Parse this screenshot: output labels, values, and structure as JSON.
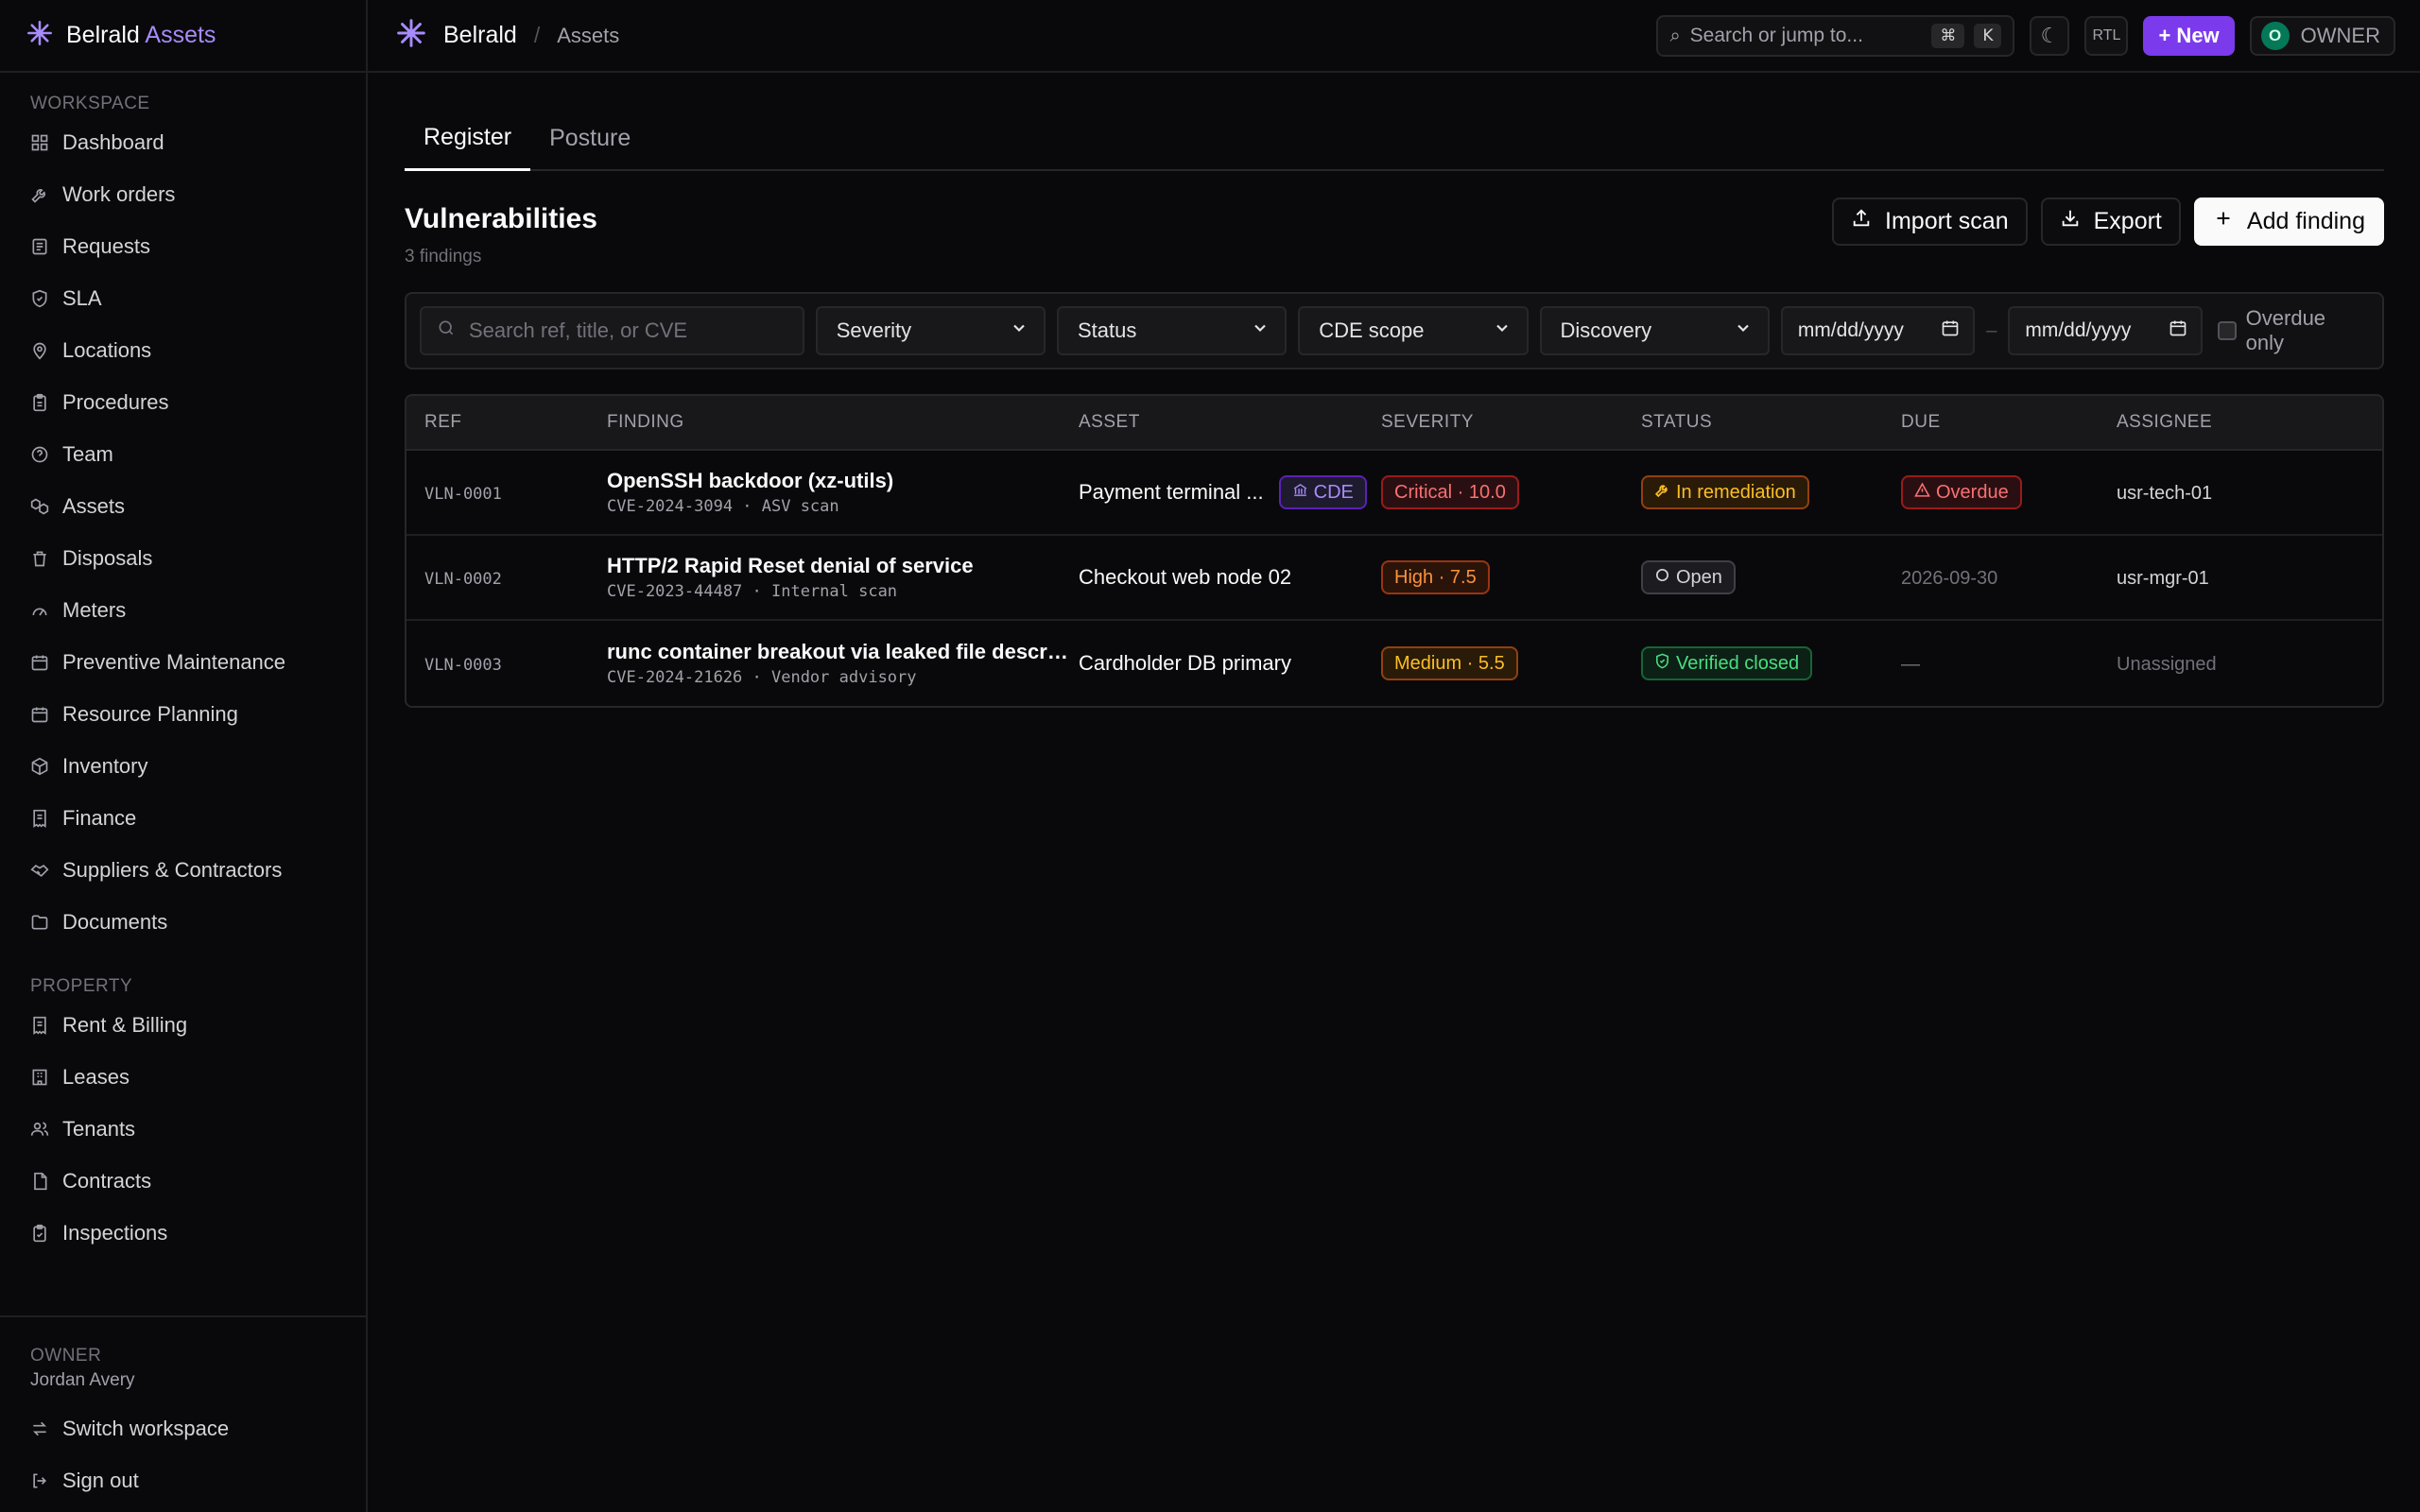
{
  "sidebar": {
    "brand": {
      "name": "Belrald",
      "accent": "Assets"
    },
    "sections": [
      {
        "label": "WORKSPACE",
        "items": [
          {
            "label": "Dashboard",
            "icon": "dashboard-icon"
          },
          {
            "label": "Work orders",
            "icon": "wrench-icon"
          },
          {
            "label": "Requests",
            "icon": "inbox-icon"
          },
          {
            "label": "SLA",
            "icon": "shield-icon"
          },
          {
            "label": "Locations",
            "icon": "pin-icon"
          },
          {
            "label": "Procedures",
            "icon": "clipboard-icon"
          },
          {
            "label": "Team",
            "icon": "help-circle-icon"
          },
          {
            "label": "Assets",
            "icon": "boxes-icon"
          },
          {
            "label": "Disposals",
            "icon": "recycle-icon"
          },
          {
            "label": "Meters",
            "icon": "gauge-icon"
          },
          {
            "label": "Preventive Maintenance",
            "icon": "calendar-icon"
          },
          {
            "label": "Resource Planning",
            "icon": "calendar-icon"
          },
          {
            "label": "Inventory",
            "icon": "package-icon"
          },
          {
            "label": "Finance",
            "icon": "receipt-icon"
          },
          {
            "label": "Suppliers & Contractors",
            "icon": "handshake-icon"
          },
          {
            "label": "Documents",
            "icon": "folder-icon"
          }
        ]
      },
      {
        "label": "PROPERTY",
        "items": [
          {
            "label": "Rent & Billing",
            "icon": "receipt-icon"
          },
          {
            "label": "Leases",
            "icon": "building-icon"
          },
          {
            "label": "Tenants",
            "icon": "users-icon"
          },
          {
            "label": "Contracts",
            "icon": "file-icon"
          },
          {
            "label": "Inspections",
            "icon": "clipboard-check-icon"
          }
        ]
      }
    ],
    "footer": {
      "role": "OWNER",
      "user": "Jordan Avery",
      "switch_label": "Switch workspace",
      "signout_label": "Sign out"
    }
  },
  "topbar": {
    "crumb_main": "Belrald",
    "crumb_sep": "/",
    "crumb_sub": "Assets",
    "search_placeholder": "Search or jump to...",
    "kbd_cmd": "⌘",
    "kbd_k": "K",
    "rtl_label": "RTL",
    "new_label": "+ New",
    "avatar_initial": "O",
    "owner_label": "OWNER"
  },
  "tabs": [
    {
      "label": "Register",
      "active": true
    },
    {
      "label": "Posture",
      "active": false
    }
  ],
  "page": {
    "title": "Vulnerabilities",
    "subtitle": "3 findings",
    "import_label": "Import scan",
    "export_label": "Export",
    "add_label": "Add finding"
  },
  "filters": {
    "search_placeholder": "Search ref, title, or CVE",
    "severity": "Severity",
    "status": "Status",
    "cde": "CDE scope",
    "discovery": "Discovery",
    "date_from": "mm/dd/yyyy",
    "date_sep": "–",
    "date_to": "mm/dd/yyyy",
    "overdue_label": "Overdue only"
  },
  "table": {
    "headers": {
      "ref": "REF",
      "finding": "FINDING",
      "asset": "ASSET",
      "severity": "SEVERITY",
      "status": "STATUS",
      "due": "DUE",
      "assignee": "ASSIGNEE"
    },
    "rows": [
      {
        "ref": "VLN-0001",
        "title": "OpenSSH backdoor (xz-utils)",
        "meta": "CVE-2024-3094 · ASV scan",
        "asset": "Payment terminal ...",
        "cde": "CDE",
        "severity": "Critical · 10.0",
        "status": "In remediation",
        "due": "Overdue",
        "assignee": "usr-tech-01"
      },
      {
        "ref": "VLN-0002",
        "title": "HTTP/2 Rapid Reset denial of service",
        "meta": "CVE-2023-44487 · Internal scan",
        "asset": "Checkout web node 02",
        "severity": "High · 7.5",
        "status": "Open",
        "due": "2026-09-30",
        "assignee": "usr-mgr-01"
      },
      {
        "ref": "VLN-0003",
        "title": "runc container breakout via leaked file descript...",
        "meta": "CVE-2024-21626 · Vendor advisory",
        "asset": "Cardholder DB primary",
        "severity": "Medium · 5.5",
        "status": "Verified closed",
        "due": "—",
        "assignee": "Unassigned"
      }
    ]
  },
  "colors": {
    "accent": "#7c3aed",
    "critical": "#f87171",
    "high": "#fb923c",
    "medium": "#fbbf24",
    "closed": "#4ade80"
  }
}
